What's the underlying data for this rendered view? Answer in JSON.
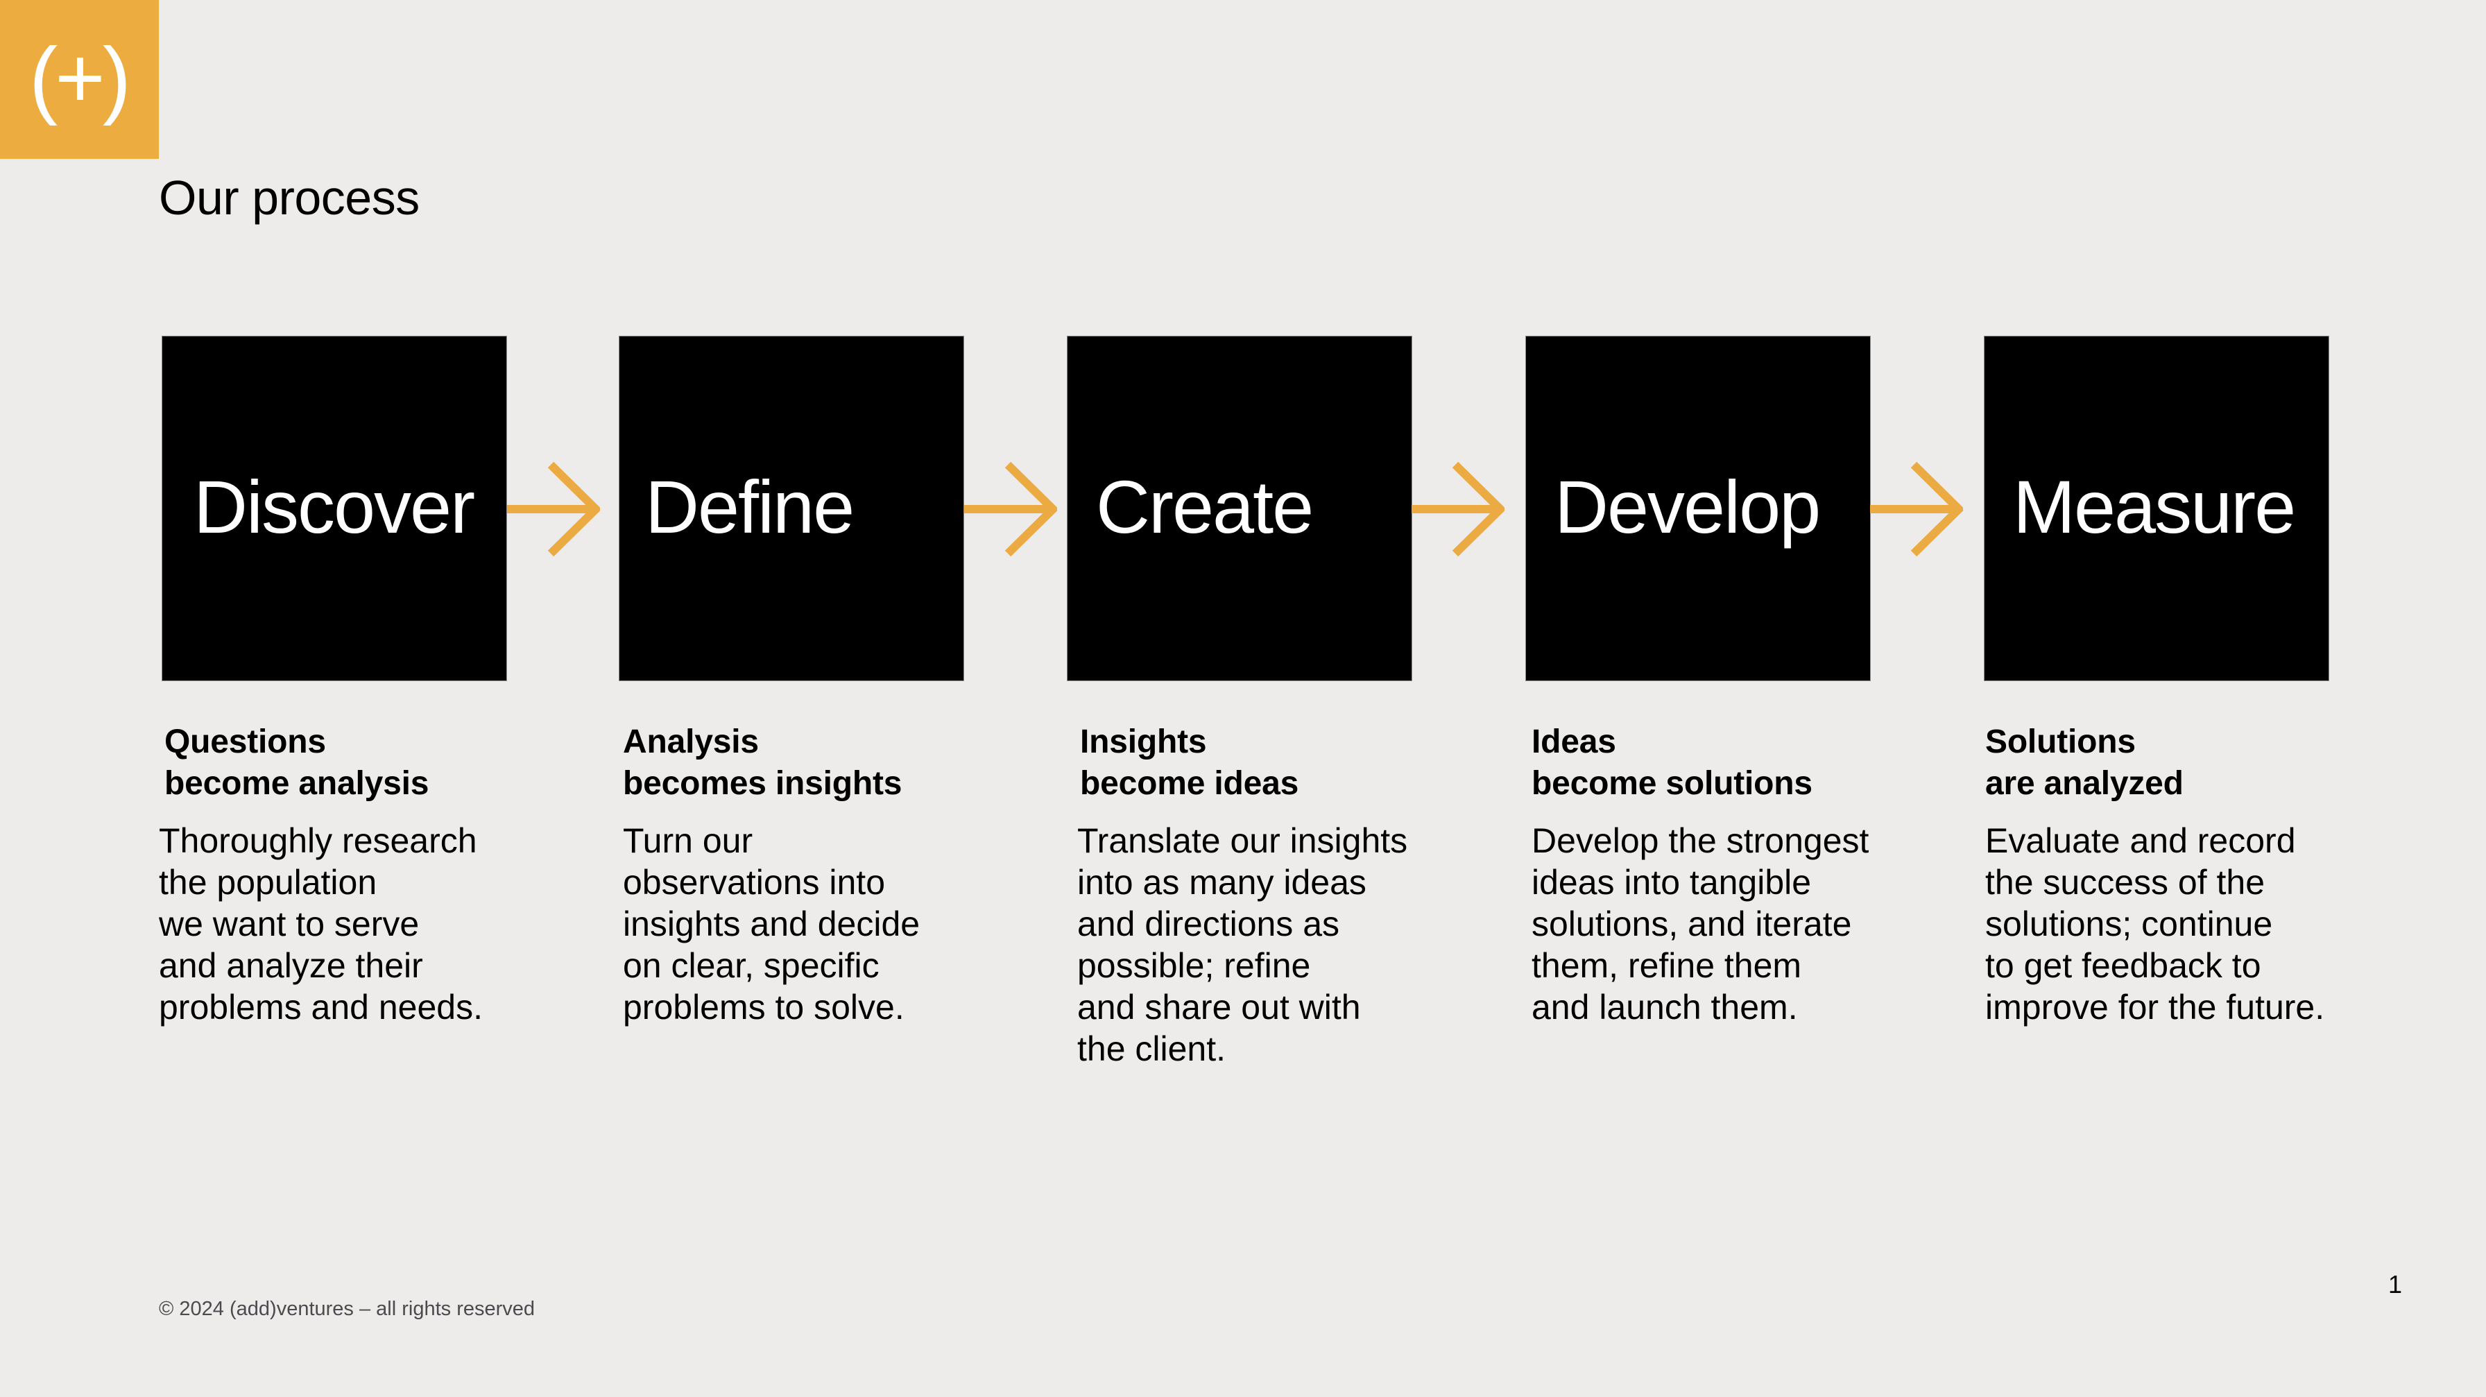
{
  "brand": {
    "logo_text": "(+)",
    "logo_icon": "add-plus-in-parentheses-logo",
    "accent_color": "#EDAC40",
    "arrow_color": "#EBAA42",
    "box_color": "#000000",
    "background_color": "#EDECEA"
  },
  "page": {
    "title": "Our process",
    "page_number": "1"
  },
  "steps": [
    {
      "label": "Discover",
      "heading": [
        "Questions",
        "become analysis"
      ],
      "body": [
        "Thoroughly research",
        "the population",
        "we want to serve",
        "and analyze their",
        "problems and needs."
      ]
    },
    {
      "label": "Define",
      "heading": [
        "Analysis",
        "becomes insights"
      ],
      "body": [
        "Turn our",
        "observations into",
        "insights and decide",
        "on clear, specific",
        "problems to solve."
      ]
    },
    {
      "label": "Create",
      "heading": [
        "Insights",
        "become ideas"
      ],
      "body": [
        "Translate our insights",
        "into as many ideas",
        "and directions as",
        "possible; refine",
        "and share out with",
        "the client."
      ]
    },
    {
      "label": "Develop",
      "heading": [
        "Ideas",
        "become solutions"
      ],
      "body": [
        "Develop the strongest",
        "ideas into tangible",
        "solutions, and iterate",
        "them, refine them",
        "and launch them."
      ]
    },
    {
      "label": "Measure",
      "heading": [
        "Solutions",
        "are analyzed"
      ],
      "body": [
        "Evaluate and record",
        "the success of the",
        "solutions; continue",
        "to get feedback to",
        "improve for the future."
      ]
    }
  ],
  "arrows": [
    {
      "icon": "arrow-right-icon",
      "from": "Discover",
      "to": "Define"
    },
    {
      "icon": "arrow-right-icon",
      "from": "Define",
      "to": "Create"
    },
    {
      "icon": "arrow-right-icon",
      "from": "Create",
      "to": "Develop"
    },
    {
      "icon": "arrow-right-icon",
      "from": "Develop",
      "to": "Measure"
    }
  ],
  "footer": {
    "copyright": "© 2024 (add)ventures – all rights reserved"
  }
}
